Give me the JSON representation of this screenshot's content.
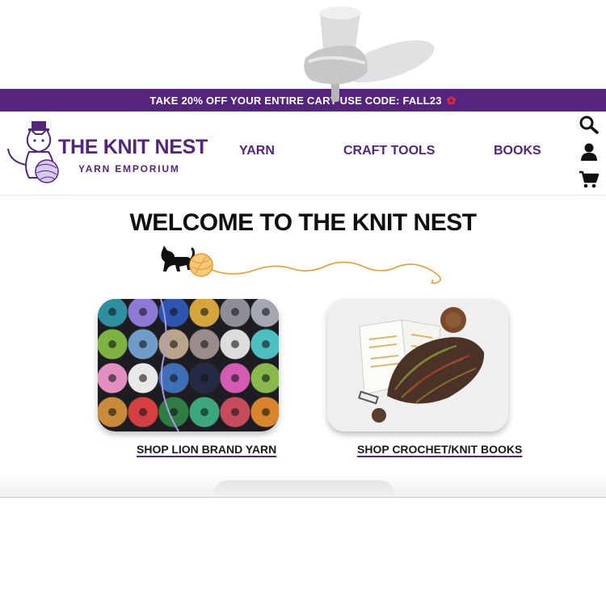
{
  "promo": {
    "text": "TAKE 20% OFF YOUR ENTIRE CART USE CODE: FALL23",
    "leaf_icon": "maple-leaf-icon",
    "background": "#55257e"
  },
  "brand": {
    "name": "THE KNIT NEST",
    "tagline": "YARN EMPORIUM",
    "color": "#55257e"
  },
  "nav": {
    "items": [
      {
        "label": "YARN"
      },
      {
        "label": "CRAFT TOOLS"
      },
      {
        "label": "BOOKS"
      }
    ]
  },
  "header_icons": [
    "search-icon",
    "account-icon",
    "cart-icon"
  ],
  "hero": {
    "title": "WELCOME TO THE KNIT NEST"
  },
  "cards": [
    {
      "link": "SHOP LION BRAND YARN"
    },
    {
      "link": "SHOP CROCHET/KNIT BOOKS"
    }
  ]
}
